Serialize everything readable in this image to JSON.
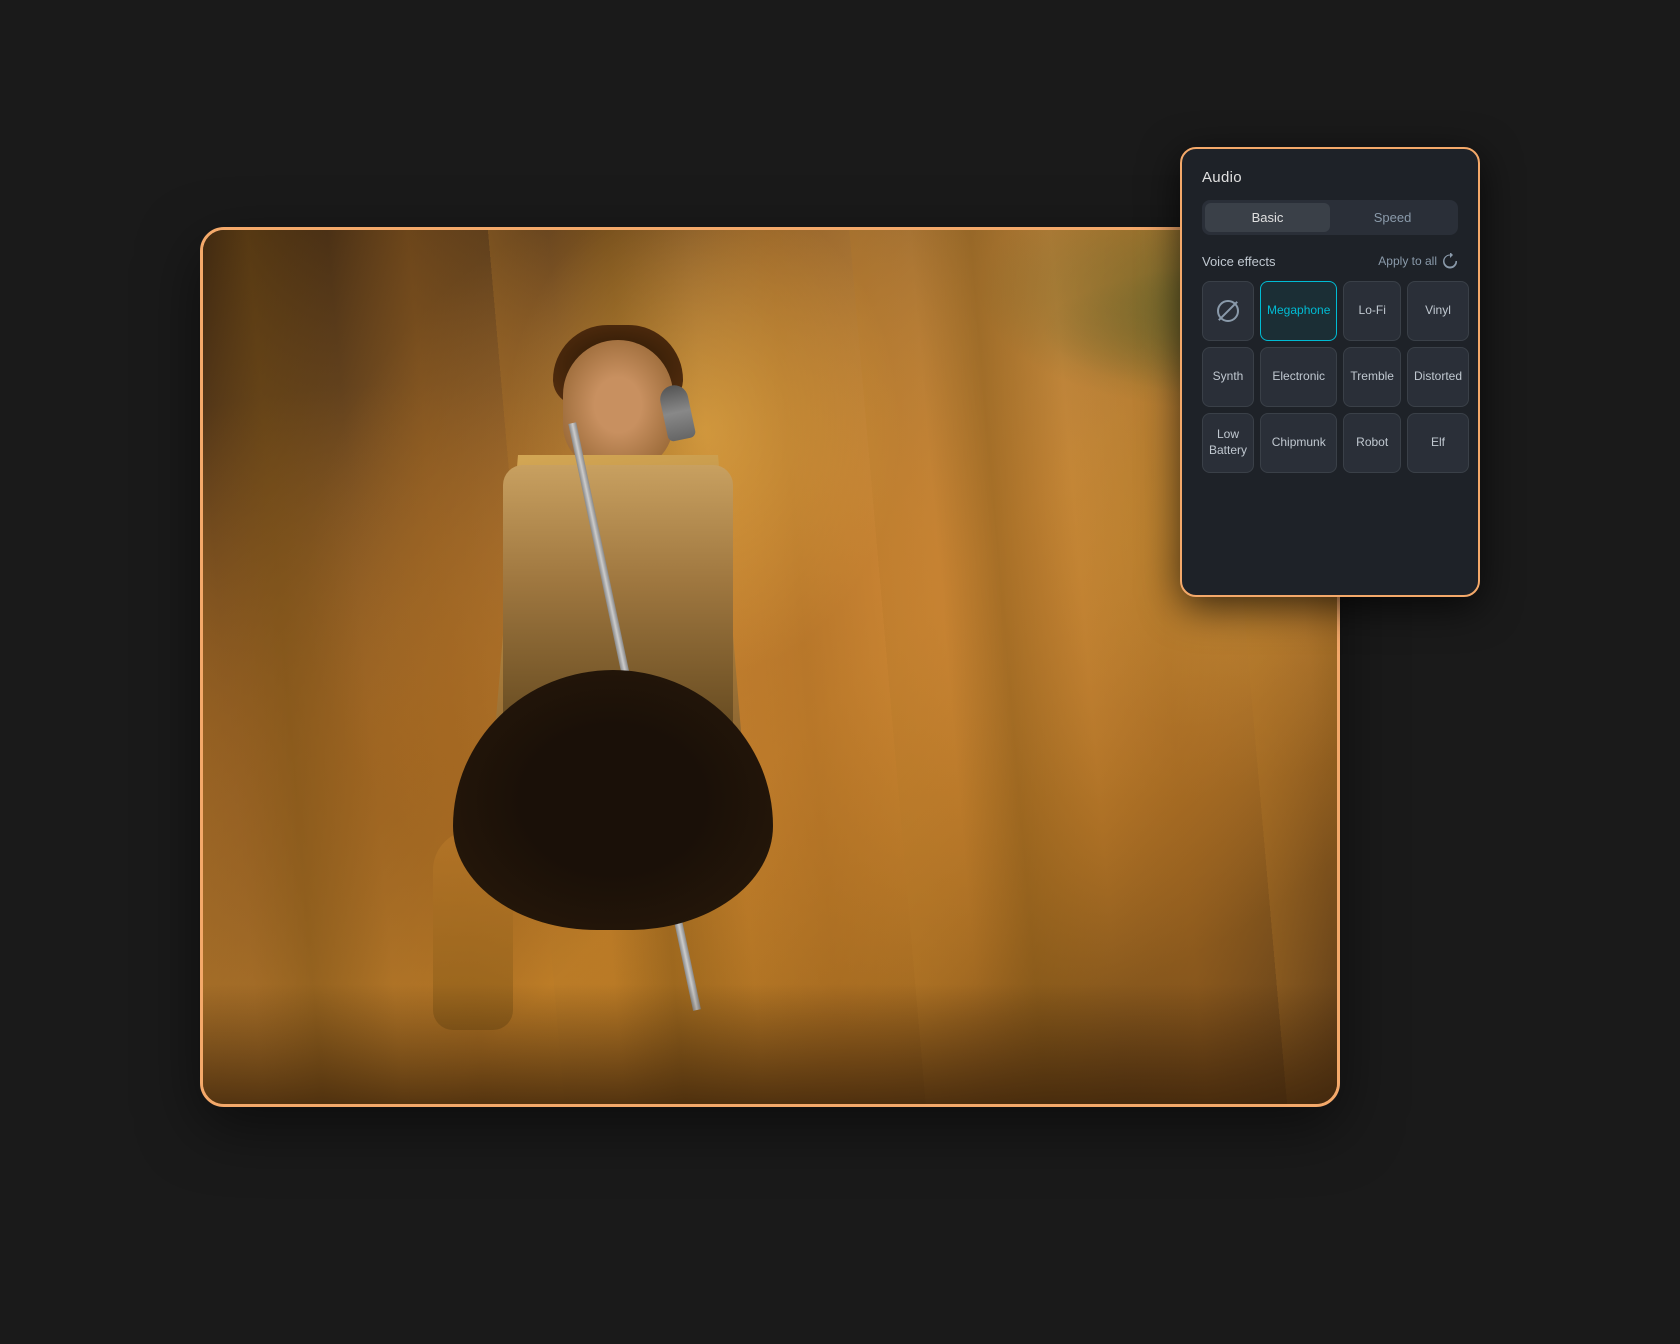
{
  "panel": {
    "title": "Audio",
    "tabs": [
      {
        "id": "basic",
        "label": "Basic",
        "active": true
      },
      {
        "id": "speed",
        "label": "Speed",
        "active": false
      }
    ],
    "voice_effects_label": "Voice effects",
    "apply_to_all_label": "Apply to all",
    "effects": [
      {
        "id": "none",
        "label": "",
        "type": "icon",
        "selected": false
      },
      {
        "id": "megaphone",
        "label": "Megaphone",
        "selected": true
      },
      {
        "id": "lofi",
        "label": "Lo-Fi",
        "selected": false
      },
      {
        "id": "vinyl",
        "label": "Vinyl",
        "selected": false
      },
      {
        "id": "synth",
        "label": "Synth",
        "selected": false
      },
      {
        "id": "electronic",
        "label": "Electronic",
        "selected": false
      },
      {
        "id": "tremble",
        "label": "Tremble",
        "selected": false
      },
      {
        "id": "distorted",
        "label": "Distorted",
        "selected": false
      },
      {
        "id": "low-battery",
        "label": "Low Battery",
        "selected": false
      },
      {
        "id": "chipmunk",
        "label": "Chipmunk",
        "selected": false
      },
      {
        "id": "robot",
        "label": "Robot",
        "selected": false
      },
      {
        "id": "elf",
        "label": "Elf",
        "selected": false
      }
    ],
    "accent_color": "#00bcd4",
    "border_color": "#f4a96a"
  },
  "photo": {
    "alt": "Singer performing on stage with guitar"
  }
}
